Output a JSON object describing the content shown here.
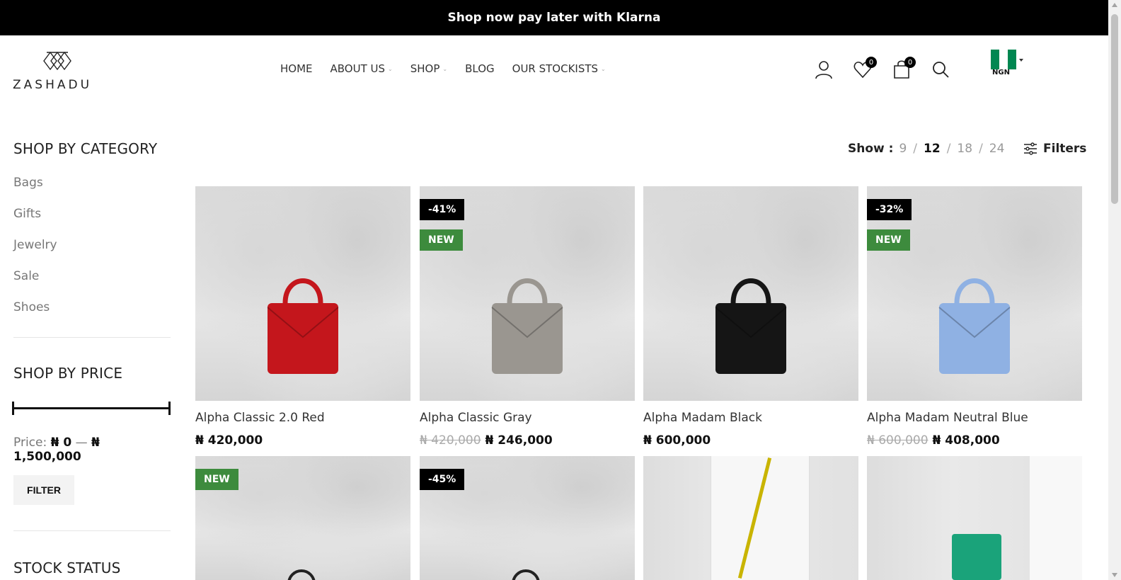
{
  "announcement": "Shop now pay later with Klarna",
  "brand": {
    "name": "ZASHADU"
  },
  "nav": [
    {
      "label": "HOME",
      "dropdown": false
    },
    {
      "label": "ABOUT US",
      "dropdown": true
    },
    {
      "label": "SHOP",
      "dropdown": true
    },
    {
      "label": "BLOG",
      "dropdown": false
    },
    {
      "label": "OUR STOCKISTS",
      "dropdown": true
    }
  ],
  "header": {
    "wishlist_count": "0",
    "cart_count": "0",
    "currency": "NGN"
  },
  "sidebar": {
    "category_title": "SHOP BY CATEGORY",
    "categories": [
      "Bags",
      "Gifts",
      "Jewelry",
      "Sale",
      "Shoes"
    ],
    "price_title": "SHOP BY PRICE",
    "price_label": "Price:",
    "price_min": "₦ 0",
    "price_dash": "—",
    "price_max": "₦ 1,500,000",
    "filter_button": "FILTER",
    "stock_title": "STOCK STATUS"
  },
  "toolbar": {
    "show_label": "Show :",
    "options": [
      "9",
      "12",
      "18",
      "24"
    ],
    "active": "12",
    "filters_label": "Filters"
  },
  "products": [
    {
      "name": "Alpha Classic 2.0 Red",
      "price": "₦ 420,000",
      "old_price": "",
      "discount": "",
      "new": false,
      "bag_color": "#c4161c"
    },
    {
      "name": "Alpha Classic Gray",
      "price": "₦ 246,000",
      "old_price": "₦ 420,000",
      "discount": "-41%",
      "new": true,
      "bag_color": "#9a9690"
    },
    {
      "name": "Alpha Madam Black",
      "price": "₦ 600,000",
      "old_price": "",
      "discount": "",
      "new": false,
      "bag_color": "#151515"
    },
    {
      "name": "Alpha Madam Neutral Blue",
      "price": "₦ 408,000",
      "old_price": "₦ 600,000",
      "discount": "-32%",
      "new": true,
      "bag_color": "#8fb1e3"
    }
  ],
  "products_row2": [
    {
      "discount": "",
      "new": true
    },
    {
      "discount": "-45%",
      "new": false
    },
    {
      "discount": "",
      "new": false
    },
    {
      "discount": "",
      "new": false
    }
  ],
  "colors": {
    "new_badge": "#3d8b3d",
    "discount_badge": "#000000"
  }
}
